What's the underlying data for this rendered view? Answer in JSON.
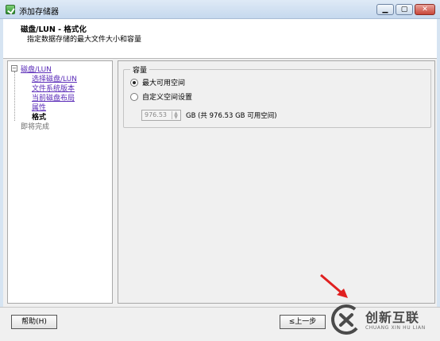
{
  "window": {
    "title": "添加存储器",
    "controls": [
      "minimize",
      "maximize",
      "close"
    ]
  },
  "header": {
    "title": "磁盘/LUN - 格式化",
    "subtitle": "指定数据存储的最大文件大小和容量"
  },
  "nav": {
    "root": "磁盘/LUN",
    "items": [
      {
        "label": "选择磁盘/LUN",
        "state": "link"
      },
      {
        "label": "文件系统版本",
        "state": "link"
      },
      {
        "label": "当前磁盘布局",
        "state": "link"
      },
      {
        "label": "属性",
        "state": "link"
      },
      {
        "label": "格式",
        "state": "current"
      }
    ],
    "finish": "即将完成"
  },
  "capacity": {
    "legend": "容量",
    "option_max": "最大可用空间",
    "option_custom": "自定义空间设置",
    "selected": "max",
    "custom_value": "976.53",
    "hint": "GB (共 976.53 GB 可用空间)"
  },
  "footer": {
    "help_label": "帮助(H)",
    "back_label": "≤上一步"
  },
  "watermark": {
    "cn": "创新互联",
    "en": "CHUANG XIN HU LIAN"
  },
  "colors": {
    "link": "#5a2bb8",
    "arrow": "#e02020",
    "logo": "#4a4a4a"
  }
}
